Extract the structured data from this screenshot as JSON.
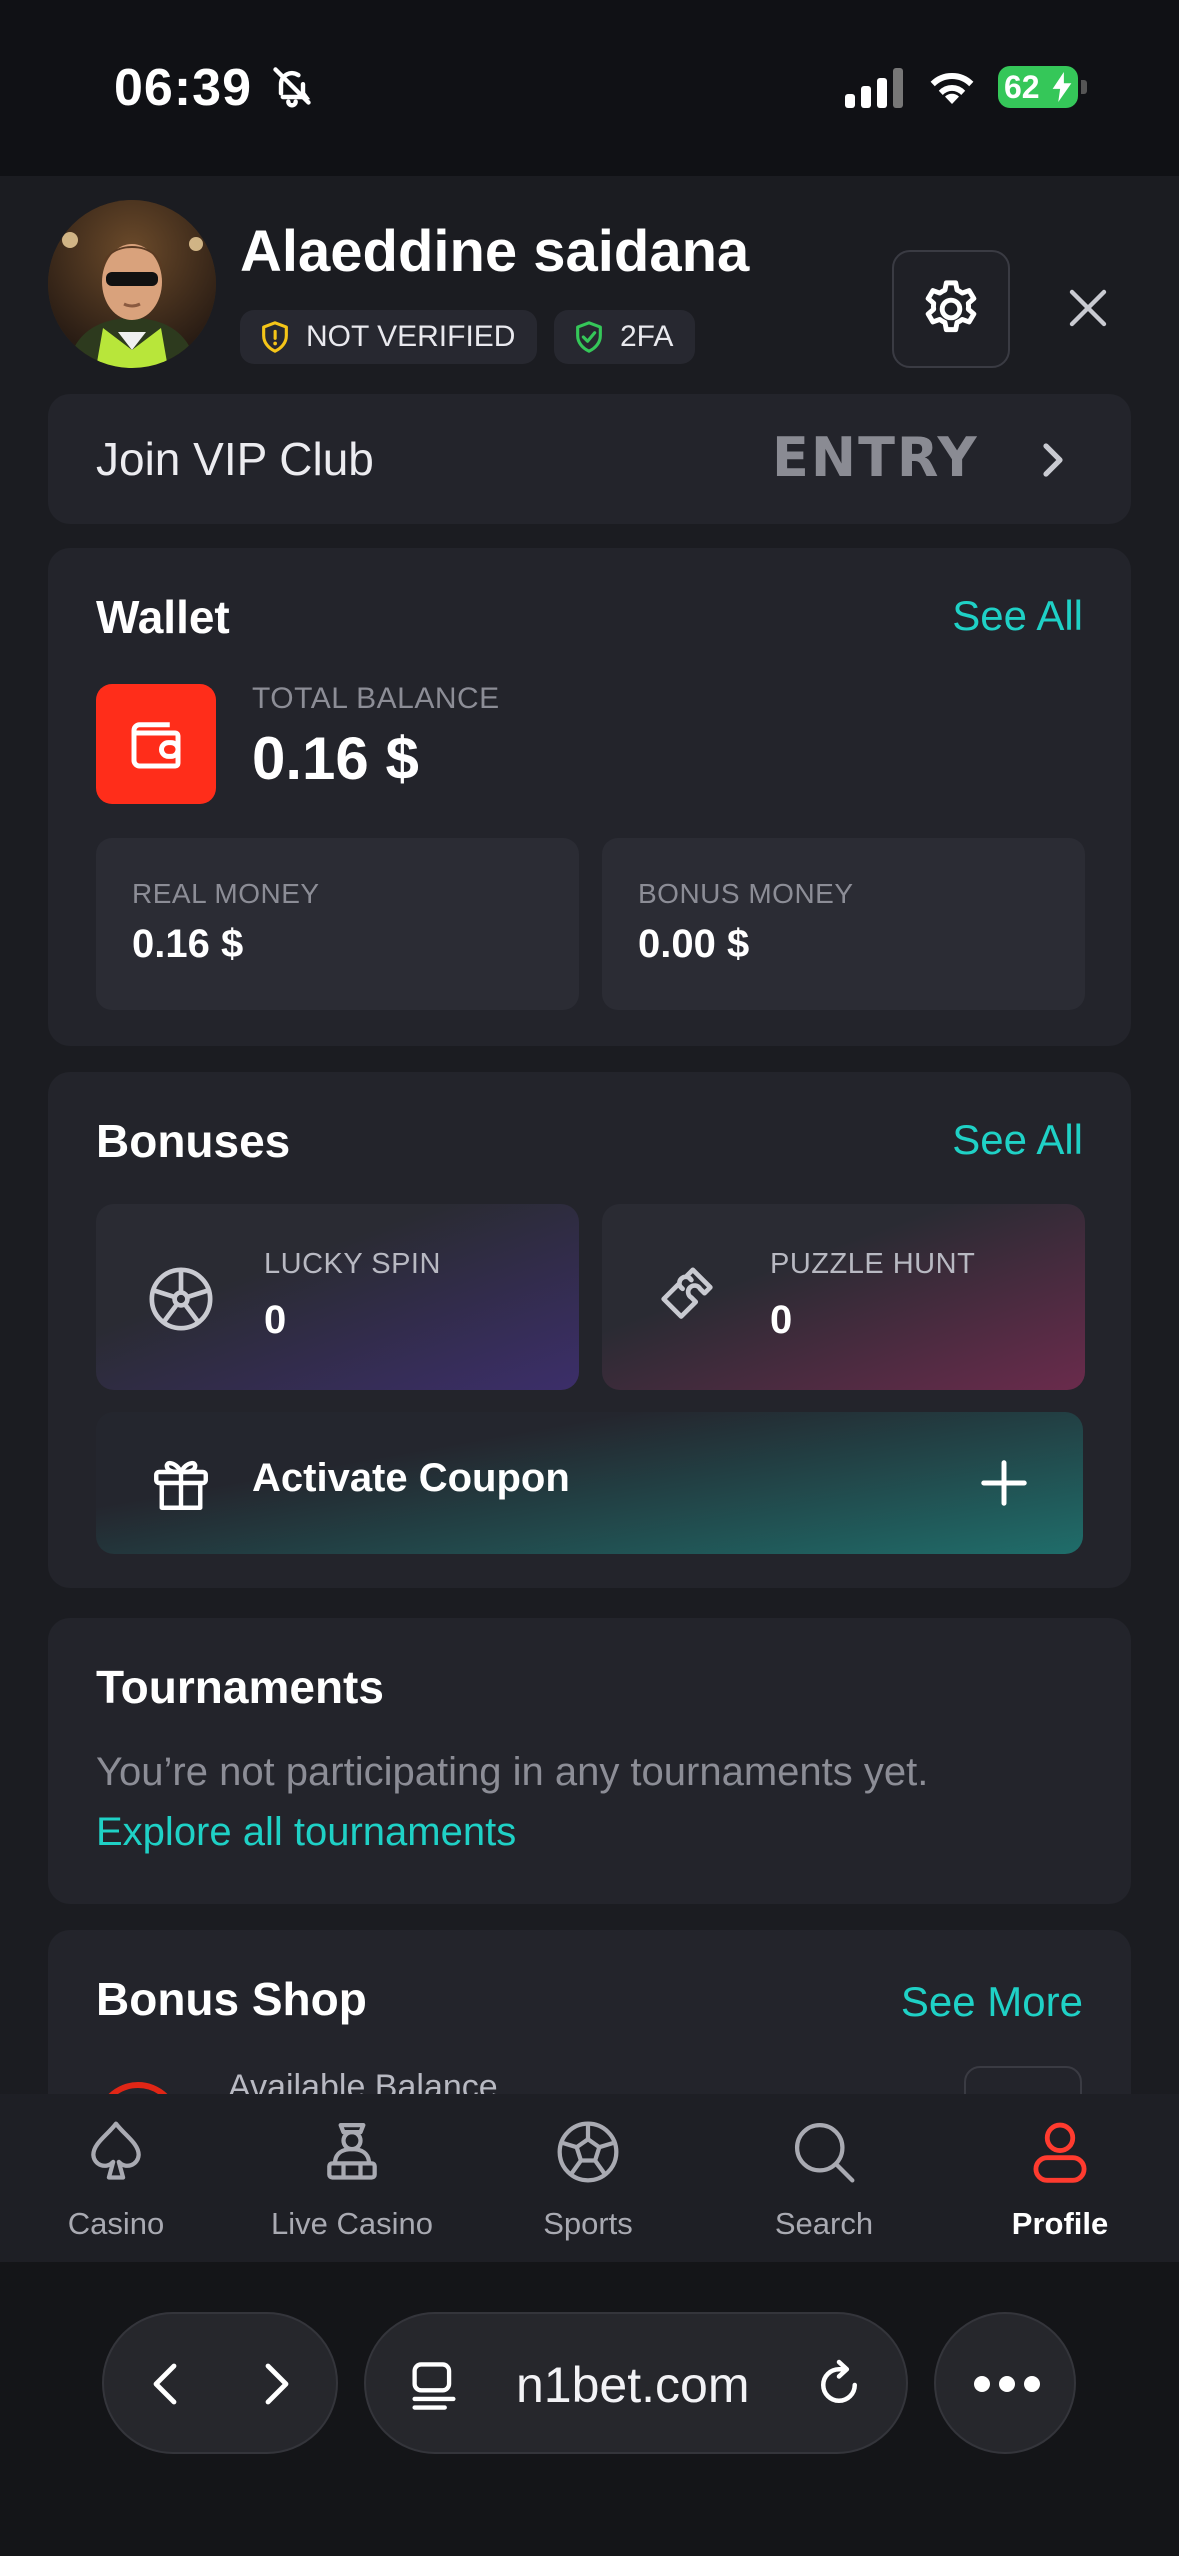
{
  "status_bar": {
    "time": "06:39",
    "battery": "62",
    "icons": [
      "bell-slash-icon",
      "cellular-signal-icon",
      "wifi-icon",
      "battery-charging-icon"
    ]
  },
  "profile": {
    "name": "Alaeddine saidana",
    "badges": {
      "not_verified": "NOT VERIFIED",
      "two_fa": "2FA"
    },
    "colors": {
      "warning": "#f5c518",
      "verified": "#35c759"
    }
  },
  "vip": {
    "label": "Join VIP Club",
    "level": "ENTRY"
  },
  "wallet": {
    "title": "Wallet",
    "see_all": "See All",
    "total_label": "TOTAL BALANCE",
    "total_value": "0.16 $",
    "real_label": "REAL MONEY",
    "real_value": "0.16 $",
    "bonus_label": "BONUS MONEY",
    "bonus_value": "0.00 $",
    "accent": "#ff2d1a"
  },
  "bonuses": {
    "title": "Bonuses",
    "see_all": "See All",
    "lucky_spin_label": "LUCKY SPIN",
    "lucky_spin_value": "0",
    "puzzle_hunt_label": "PUZZLE HUNT",
    "puzzle_hunt_value": "0",
    "coupon_label": "Activate Coupon"
  },
  "tournaments": {
    "title": "Tournaments",
    "empty_text": "You’re not participating in any tournaments yet.",
    "explore_link": "Explore all tournaments"
  },
  "bonus_shop": {
    "title": "Bonus Shop",
    "see_more": "See More",
    "available_label": "Available Balance"
  },
  "tab_bar": {
    "tabs": [
      {
        "label": "Casino",
        "icon": "spade-icon"
      },
      {
        "label": "Live Casino",
        "icon": "dealer-icon"
      },
      {
        "label": "Sports",
        "icon": "soccer-ball-icon"
      },
      {
        "label": "Search",
        "icon": "search-icon"
      },
      {
        "label": "Profile",
        "icon": "user-icon"
      }
    ],
    "active": "Profile",
    "active_color": "#ff3b2f"
  },
  "browser": {
    "url": "n1bet.com"
  },
  "theme": {
    "link_color": "#1fd1c6",
    "background": "#1b1c21",
    "card": "#23242b"
  }
}
